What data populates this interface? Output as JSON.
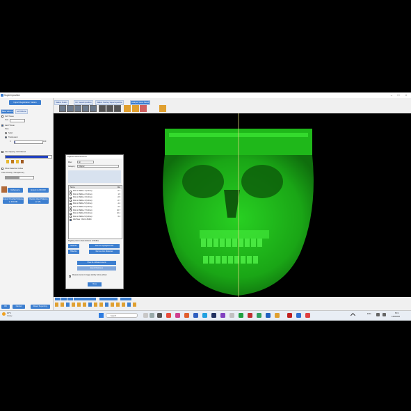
{
  "window": {
    "title": "Superimposition",
    "controls": [
      "–",
      "□",
      "×"
    ]
  },
  "left": {
    "import_button": "Import Registration Station",
    "tabs": [
      "Base Volume",
      "Left Volume"
    ],
    "soft_tissue": "Soft Tissue",
    "soft_sub": "Fwd",
    "hard_tissue": "Hard Tissue",
    "hard_sub": "Stop",
    "solid": "Solid",
    "translucent": "Translucent",
    "opacity_value": "0",
    "opacity_max": "100",
    "use_clipping": "Use Clipping: Volt Filtered",
    "show_selection": "Show Selection Cubes",
    "color_overlay": "Color Overlay: Transparency",
    "btn_reference": "Reference",
    "btn_export": "Export to DICOM",
    "btn_export_overlay": "Export Overlaid Volume to DICOM",
    "btn_overlay_settings": "Overlay Used Volume to STL",
    "bottom_buttons": [
      "OK",
      "Cancel",
      "Reset Superimp."
    ]
  },
  "toolbar": {
    "tabs": [
      "Station Fusion",
      "Vol. Superimposition",
      "Station Overlay Superimposition",
      "Analysis Views Result"
    ],
    "active_tab": 3
  },
  "dialog": {
    "title": "Digitized Measurements",
    "filter_label": "Filter:",
    "filter_value": "All",
    "category_label": "Category:",
    "category_value": "Chapter",
    "col_name": "Name",
    "col_value": "Dist",
    "rows": [
      {
        "name": "Dist to Midline 1 (Inches)",
        "value": "-0.7",
        "checked": false
      },
      {
        "name": "Dist to Midline 2 (Inches)",
        "value": "1.5",
        "checked": false
      },
      {
        "name": "Dist to Midline 3 (Inches)",
        "value": "-0.5",
        "checked": false
      },
      {
        "name": "Dist to Midline 4 (Inches)",
        "value": "-0.7",
        "checked": false
      },
      {
        "name": "Dist to Midline 5 (Inches)",
        "value": "-1.2",
        "checked": false
      },
      {
        "name": "Dist to Midline 6 (Inches)",
        "value": "-2.0",
        "checked": false
      },
      {
        "name": "Dist to Midline 7 (Inches)",
        "value": "10.7",
        "checked": false
      },
      {
        "name": "Dist to Midline 8 (Inches)",
        "value": "10.1",
        "checked": false
      },
      {
        "name": "Dist to Midline 9 (Inches)",
        "value": "6.2",
        "checked": false
      },
      {
        "name": "Add New - Dist to Midlin",
        "value": "",
        "checked": true
      }
    ],
    "hint": "Register point to show distance to Midline",
    "btn_add": "Measure",
    "btn_remove_all": "Remove Highlighted Dist",
    "btn_hide": "Hide ALL",
    "btn_remove_marked": "Remove ALL Distances",
    "btn_show_all": "Show ALL Measurements",
    "btn_export": "Export Distances",
    "option_text": "Measure items on images identify volume shown",
    "btn_close": "Close"
  },
  "taskbar": {
    "weather_temp": "16°C",
    "weather_desc": "Cloudy",
    "search_placeholder": "Search",
    "lang": "ENG",
    "time": "8:19",
    "date": "13/03/2024"
  },
  "colors": {
    "accent": "#3d7fd0",
    "skull": "#22c41c",
    "viewport_bg": "#000000"
  }
}
